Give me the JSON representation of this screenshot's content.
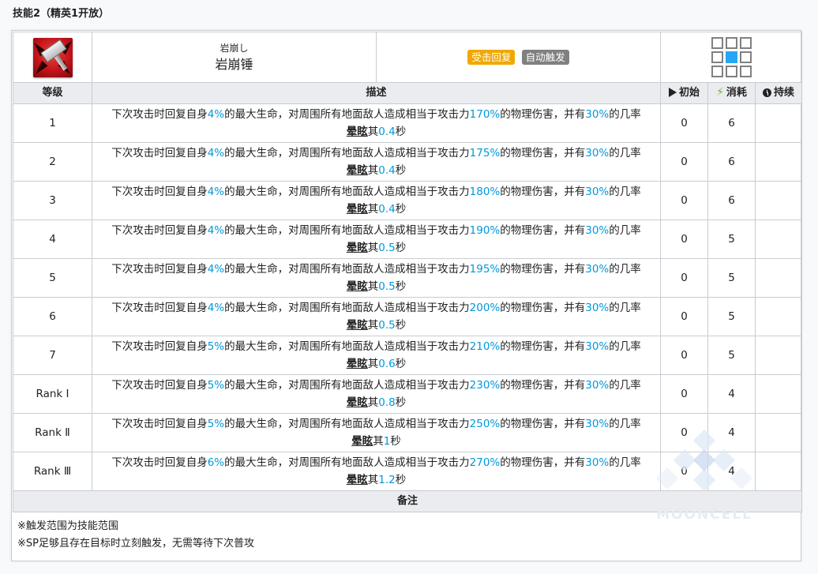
{
  "page_title": "技能2（精英1开放）",
  "skill": {
    "name_jp": "岩崩し",
    "name_cn": "岩崩锤",
    "icon": "hammer-skill-icon",
    "tags": [
      "受击回复",
      "自动触发"
    ],
    "tag_colors": {
      "sp": "#f0a800",
      "trigger": "#808080"
    },
    "range_icon": "attack-range-grid"
  },
  "table": {
    "headers": {
      "level": "等级",
      "description": "描述",
      "initial": "初始",
      "cost": "消耗",
      "duration": "持续"
    },
    "desc_text": {
      "part1": "下次攻击时回复自身",
      "part2": "的最大生命，对周围所有地面敌人造成相当于攻击力",
      "part3": "的物理伤害，并有",
      "part4": "的几率",
      "term": "晕眩",
      "part5": "其",
      "unit": "秒"
    },
    "rows": [
      {
        "level": "1",
        "heal": "4%",
        "atk": "170%",
        "chance": "30%",
        "stun": "0.4",
        "initial": "0",
        "cost": "6",
        "duration": ""
      },
      {
        "level": "2",
        "heal": "4%",
        "atk": "175%",
        "chance": "30%",
        "stun": "0.4",
        "initial": "0",
        "cost": "6",
        "duration": ""
      },
      {
        "level": "3",
        "heal": "4%",
        "atk": "180%",
        "chance": "30%",
        "stun": "0.4",
        "initial": "0",
        "cost": "6",
        "duration": ""
      },
      {
        "level": "4",
        "heal": "4%",
        "atk": "190%",
        "chance": "30%",
        "stun": "0.5",
        "initial": "0",
        "cost": "5",
        "duration": ""
      },
      {
        "level": "5",
        "heal": "4%",
        "atk": "195%",
        "chance": "30%",
        "stun": "0.5",
        "initial": "0",
        "cost": "5",
        "duration": ""
      },
      {
        "level": "6",
        "heal": "4%",
        "atk": "200%",
        "chance": "30%",
        "stun": "0.5",
        "initial": "0",
        "cost": "5",
        "duration": ""
      },
      {
        "level": "7",
        "heal": "5%",
        "atk": "210%",
        "chance": "30%",
        "stun": "0.6",
        "initial": "0",
        "cost": "5",
        "duration": ""
      },
      {
        "level": "Rank Ⅰ",
        "heal": "5%",
        "atk": "230%",
        "chance": "30%",
        "stun": "0.8",
        "initial": "0",
        "cost": "4",
        "duration": ""
      },
      {
        "level": "Rank Ⅱ",
        "heal": "5%",
        "atk": "250%",
        "chance": "30%",
        "stun": "1",
        "initial": "0",
        "cost": "4",
        "duration": ""
      },
      {
        "level": "Rank Ⅲ",
        "heal": "6%",
        "atk": "270%",
        "chance": "30%",
        "stun": "1.2",
        "initial": "0",
        "cost": "4",
        "duration": ""
      }
    ],
    "notes_header": "备注"
  },
  "notes": [
    "※触发范围为技能范围",
    "※SP足够且存在目标时立刻触发，无需等待下次普攻"
  ],
  "watermark": "MOONCELL",
  "highlight_color": "#0098dc"
}
